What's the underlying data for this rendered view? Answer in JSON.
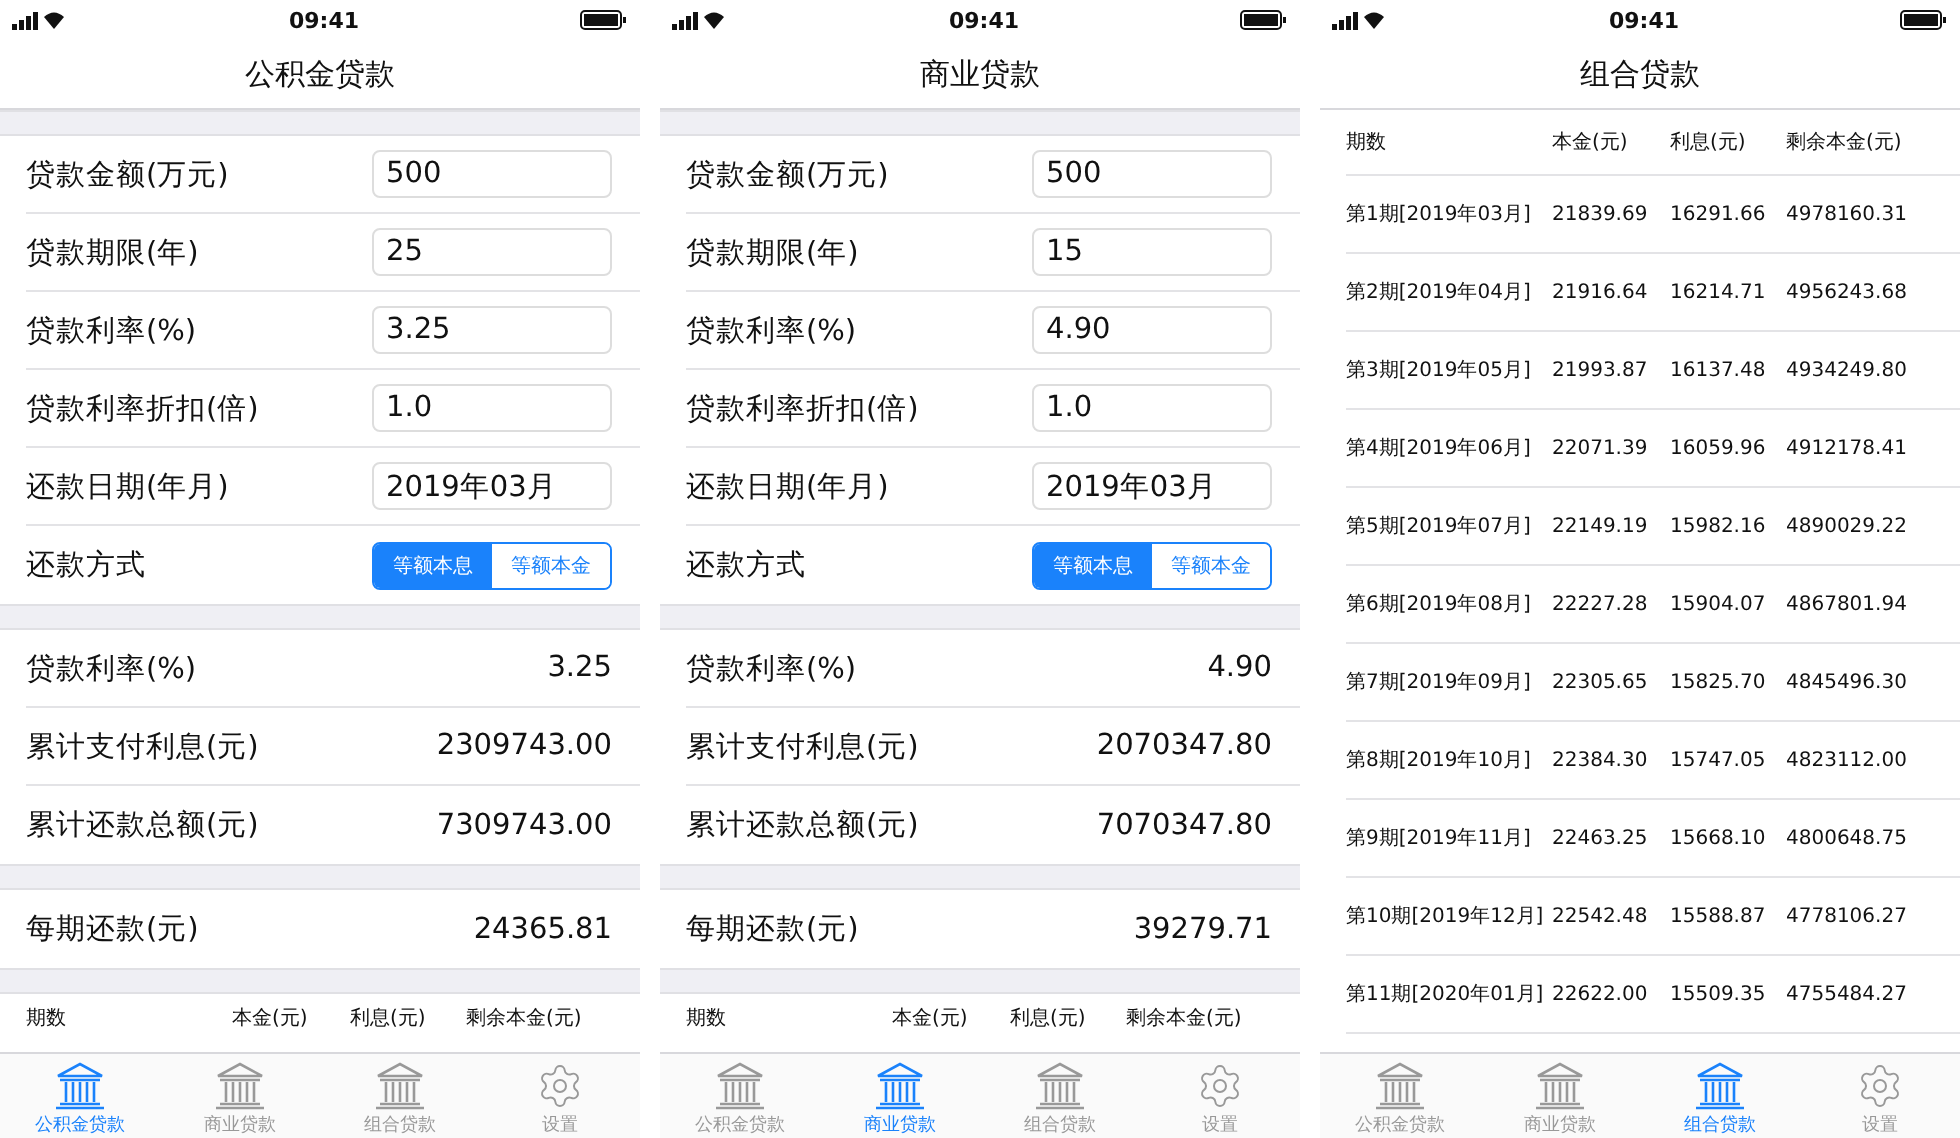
{
  "screens": [
    {
      "kind": "calculator",
      "status_bar": {
        "time": "09:41"
      },
      "title": "公积金贷款",
      "fields": [
        {
          "label": "贷款金额(万元)",
          "value": "500"
        },
        {
          "label": "贷款期限(年)",
          "value": "25"
        },
        {
          "label": "贷款利率(%)",
          "value": "3.25"
        },
        {
          "label": "贷款利率折扣(倍)",
          "value": "1.0"
        },
        {
          "label": "还款日期(年月)",
          "value": "2019年03月"
        }
      ],
      "repayment": {
        "label": "还款方式",
        "options": [
          {
            "label": "等额本息",
            "selected": true
          },
          {
            "label": "等额本金",
            "selected": false
          }
        ]
      },
      "results": [
        {
          "label": "贷款利率(%)",
          "value": "3.25"
        },
        {
          "label": "累计支付利息(元)",
          "value": "2309743.00"
        },
        {
          "label": "累计还款总额(元)",
          "value": "7309743.00"
        }
      ],
      "monthly": {
        "label": "每期还款(元)",
        "value": "24365.81"
      },
      "schedule": {
        "columns": [
          "期数",
          "本金(元)",
          "利息(元)",
          "剩余本金(元)"
        ]
      },
      "tab_bar": [
        {
          "label": "公积金贷款",
          "kind": "bank",
          "selected": true
        },
        {
          "label": "商业贷款",
          "kind": "bank",
          "selected": false
        },
        {
          "label": "组合贷款",
          "kind": "bank",
          "selected": false
        },
        {
          "label": "设置",
          "kind": "gear",
          "selected": false
        }
      ]
    },
    {
      "kind": "calculator",
      "status_bar": {
        "time": "09:41"
      },
      "title": "商业贷款",
      "fields": [
        {
          "label": "贷款金额(万元)",
          "value": "500"
        },
        {
          "label": "贷款期限(年)",
          "value": "15"
        },
        {
          "label": "贷款利率(%)",
          "value": "4.90"
        },
        {
          "label": "贷款利率折扣(倍)",
          "value": "1.0"
        },
        {
          "label": "还款日期(年月)",
          "value": "2019年03月"
        }
      ],
      "repayment": {
        "label": "还款方式",
        "options": [
          {
            "label": "等额本息",
            "selected": true
          },
          {
            "label": "等额本金",
            "selected": false
          }
        ]
      },
      "results": [
        {
          "label": "贷款利率(%)",
          "value": "4.90"
        },
        {
          "label": "累计支付利息(元)",
          "value": "2070347.80"
        },
        {
          "label": "累计还款总额(元)",
          "value": "7070347.80"
        }
      ],
      "monthly": {
        "label": "每期还款(元)",
        "value": "39279.71"
      },
      "schedule": {
        "columns": [
          "期数",
          "本金(元)",
          "利息(元)",
          "剩余本金(元)"
        ]
      },
      "tab_bar": [
        {
          "label": "公积金贷款",
          "kind": "bank",
          "selected": false
        },
        {
          "label": "商业贷款",
          "kind": "bank",
          "selected": true
        },
        {
          "label": "组合贷款",
          "kind": "bank",
          "selected": false
        },
        {
          "label": "设置",
          "kind": "gear",
          "selected": false
        }
      ]
    },
    {
      "kind": "schedule",
      "status_bar": {
        "time": "09:41"
      },
      "title": "组合贷款",
      "schedule": {
        "columns": [
          "期数",
          "本金(元)",
          "利息(元)",
          "剩余本金(元)"
        ],
        "rows": [
          [
            "第1期[2019年03月]",
            "21839.69",
            "16291.66",
            "4978160.31"
          ],
          [
            "第2期[2019年04月]",
            "21916.64",
            "16214.71",
            "4956243.68"
          ],
          [
            "第3期[2019年05月]",
            "21993.87",
            "16137.48",
            "4934249.80"
          ],
          [
            "第4期[2019年06月]",
            "22071.39",
            "16059.96",
            "4912178.41"
          ],
          [
            "第5期[2019年07月]",
            "22149.19",
            "15982.16",
            "4890029.22"
          ],
          [
            "第6期[2019年08月]",
            "22227.28",
            "15904.07",
            "4867801.94"
          ],
          [
            "第7期[2019年09月]",
            "22305.65",
            "15825.70",
            "4845496.30"
          ],
          [
            "第8期[2019年10月]",
            "22384.30",
            "15747.05",
            "4823112.00"
          ],
          [
            "第9期[2019年11月]",
            "22463.25",
            "15668.10",
            "4800648.75"
          ],
          [
            "第10期[2019年12月]",
            "22542.48",
            "15588.87",
            "4778106.27"
          ],
          [
            "第11期[2020年01月]",
            "22622.00",
            "15509.35",
            "4755484.27"
          ]
        ]
      },
      "tab_bar": [
        {
          "label": "公积金贷款",
          "kind": "bank",
          "selected": false
        },
        {
          "label": "商业贷款",
          "kind": "bank",
          "selected": false
        },
        {
          "label": "组合贷款",
          "kind": "bank",
          "selected": true
        },
        {
          "label": "设置",
          "kind": "gear",
          "selected": false
        }
      ]
    }
  ]
}
